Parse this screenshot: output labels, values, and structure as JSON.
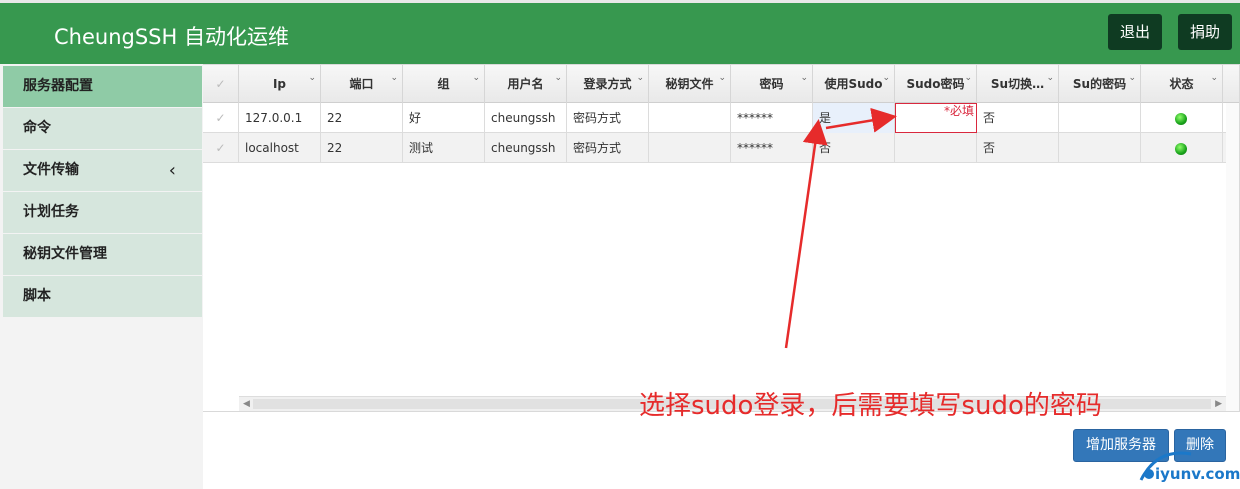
{
  "app": {
    "title": "CheungSSH 自动化运维"
  },
  "topbar": {
    "logout_label": "退出",
    "donate_label": "捐助"
  },
  "sidebar": {
    "items": [
      {
        "label": "服务器配置",
        "active": true
      },
      {
        "label": "命令"
      },
      {
        "label": "文件传输",
        "has_chevron": true
      },
      {
        "label": "计划任务"
      },
      {
        "label": "秘钥文件管理"
      },
      {
        "label": "脚本"
      }
    ],
    "chevron": "‹"
  },
  "grid": {
    "columns": [
      "",
      "Ip",
      "端口",
      "组",
      "用户名",
      "登录方式",
      "秘钥文件",
      "密码",
      "使用Sudo",
      "Sudo密码",
      "Su切换…",
      "Su的密码",
      "状态"
    ],
    "rows": [
      [
        "✓",
        "127.0.0.1",
        "22",
        "好",
        "cheungssh",
        "密码方式",
        "",
        "******",
        "是",
        "",
        "否",
        "",
        ""
      ],
      [
        "✓",
        "localhost",
        "22",
        "测试",
        "cheungssh",
        "密码方式",
        "",
        "******",
        "否",
        "",
        "否",
        "",
        ""
      ]
    ],
    "required_marker": "*必填",
    "status_color": "#19a31b"
  },
  "annotation": {
    "text": "选择sudo登录，后需要填写sudo的密码",
    "color": "#e62b2b"
  },
  "actions": {
    "add_server_label": "增加服务器",
    "delete_label": "删除"
  },
  "watermark": {
    "text": "iyunv.com"
  }
}
